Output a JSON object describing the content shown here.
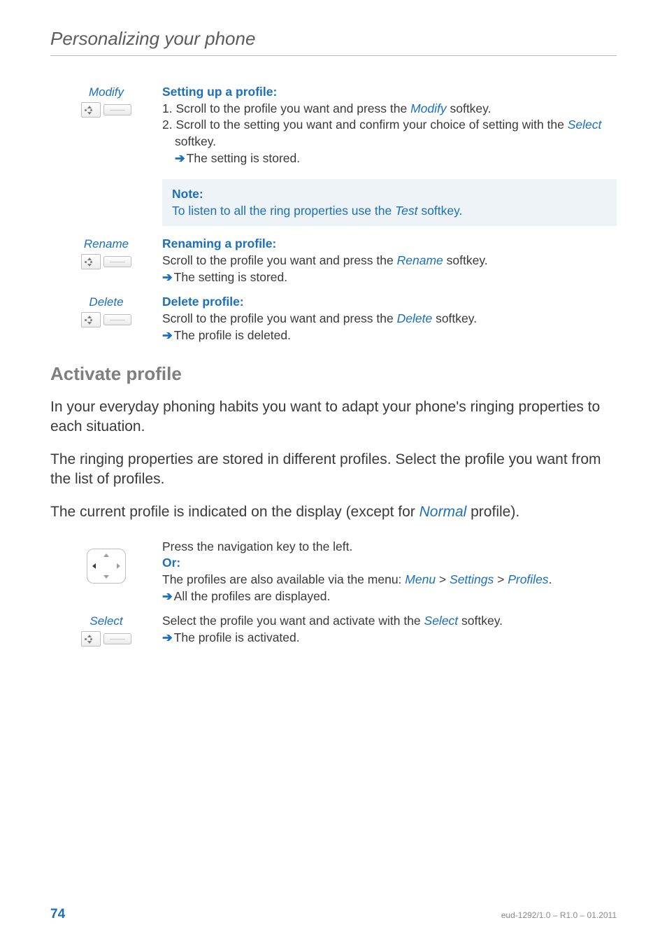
{
  "running_head": "Personalizing your phone",
  "modify": {
    "label": "Modify",
    "heading": "Setting up a profile:",
    "step1_pre": "1. Scroll to the profile you want and press the ",
    "step1_key": "Modify",
    "step1_post": " softkey.",
    "step2_pre": "2. Scroll to the setting you want and confirm your choice of setting with the ",
    "step2_key": "Select",
    "step2_post": " softkey.",
    "result": "The setting is stored."
  },
  "note": {
    "title": "Note:",
    "body_pre": "To listen to all the ring properties use the ",
    "body_key": "Test",
    "body_post": " softkey."
  },
  "rename": {
    "label": "Rename",
    "heading": "Renaming a profile:",
    "line_pre": "Scroll to the profile you want and press the ",
    "line_key": "Rename",
    "line_post": " softkey.",
    "result": "The setting is stored."
  },
  "delete": {
    "label": "Delete",
    "heading": "Delete profile:",
    "line_pre": "Scroll to the profile you want and press the ",
    "line_key": "Delete",
    "line_post": " softkey.",
    "result": "The profile is deleted."
  },
  "section_title": "Activate profile",
  "para1": "In your everyday phoning habits you want to adapt your phone's ringing properties to each situation.",
  "para2": "The ringing properties are stored in different profiles. Select the profile you want from the list of profiles.",
  "para3_pre": "The current profile is indicated on the display (except for ",
  "para3_key": "Normal",
  "para3_post": " profile).",
  "navstep": {
    "line1": "Press the navigation key to the left.",
    "or": "Or:",
    "line2_pre": "The profiles are also available via the menu: ",
    "m1": "Menu",
    "gt1": " > ",
    "m2": "Settings",
    "gt2": " > ",
    "m3": "Profiles",
    "line2_post": ".",
    "result": "All the profiles are displayed."
  },
  "select": {
    "label": "Select",
    "line_pre": "Select the profile you want and activate with the ",
    "line_key": "Select",
    "line_post": " softkey.",
    "result": "The profile is activated."
  },
  "footer": {
    "page": "74",
    "meta": "eud-1292/1.0 – R1.0 – 01.2011"
  }
}
